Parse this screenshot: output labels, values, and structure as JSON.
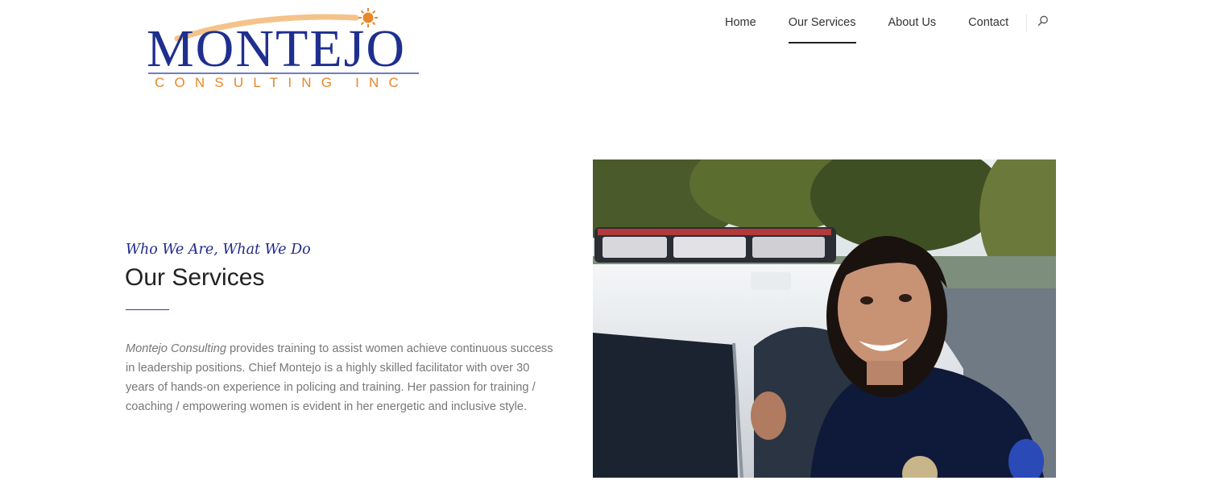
{
  "logo": {
    "main_text": "MONTEJO",
    "sub_text": "CONSULTING INC",
    "icon": "sun-icon",
    "colors": {
      "navy": "#1f2f8f",
      "orange": "#e8872a"
    }
  },
  "nav": {
    "items": [
      {
        "label": "Home",
        "active": false
      },
      {
        "label": "Our Services",
        "active": true
      },
      {
        "label": "About Us",
        "active": false
      },
      {
        "label": "Contact",
        "active": false
      }
    ],
    "search_icon": "search-icon"
  },
  "content": {
    "tagline": "Who We Are, What We Do",
    "title": "Our Services",
    "description_lead": "Montejo Consulting",
    "description_rest": " provides training to assist women achieve continuous success in leadership positions. Chief Montejo is a highly skilled facilitator with over 30 years of hands-on experience in policing and training. Her passion for training / coaching / empowering women is evident in her energetic and inclusive style."
  },
  "hero": {
    "subject": "smiling female police officer beside patrol car"
  },
  "colors": {
    "accent": "#1f2a8c",
    "text_muted": "#777777"
  }
}
